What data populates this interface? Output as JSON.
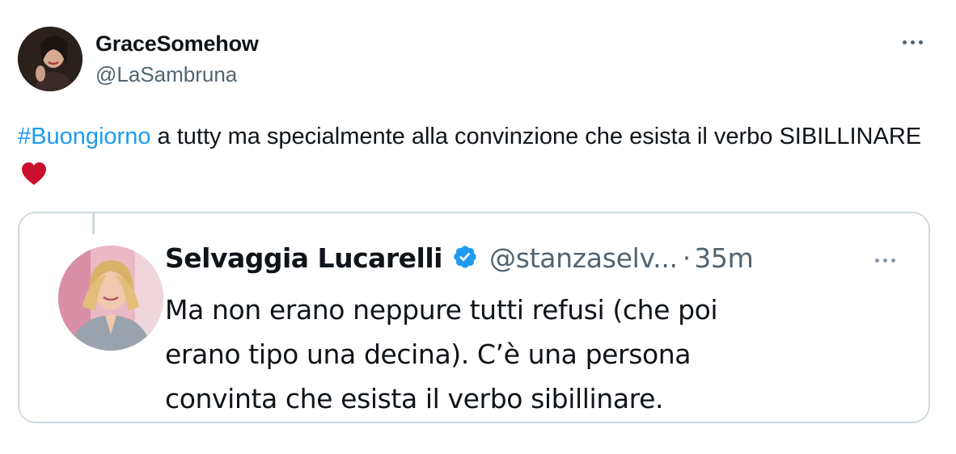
{
  "author": {
    "display_name": "GraceSomehow",
    "handle": "@LaSambruna",
    "avatar_icon": "user-avatar-photo"
  },
  "tweet": {
    "hashtag": "#Buongiorno",
    "text": " a tutty ma specialmente alla convinzione che esista il verbo SIBILLINARE",
    "emoji_icon": "red-heart-icon",
    "more_icon": "more-options-icon"
  },
  "quoted": {
    "display_name": "Selvaggia Lucarelli",
    "verified_icon": "verified-badge-icon",
    "handle": "@stanzaselv...",
    "separator": "·",
    "time": "35m",
    "lines": [
      "Ma non erano neppure tutti refusi (che poi",
      "erano tipo una decina). C’è una persona",
      "convinta che esista il verbo sibillinare."
    ]
  },
  "colors": {
    "link": "#1d9bf0",
    "secondary_text": "#536471",
    "border": "#cfd9de",
    "heart": "#c8102e",
    "verified": "#1d9bf0"
  }
}
